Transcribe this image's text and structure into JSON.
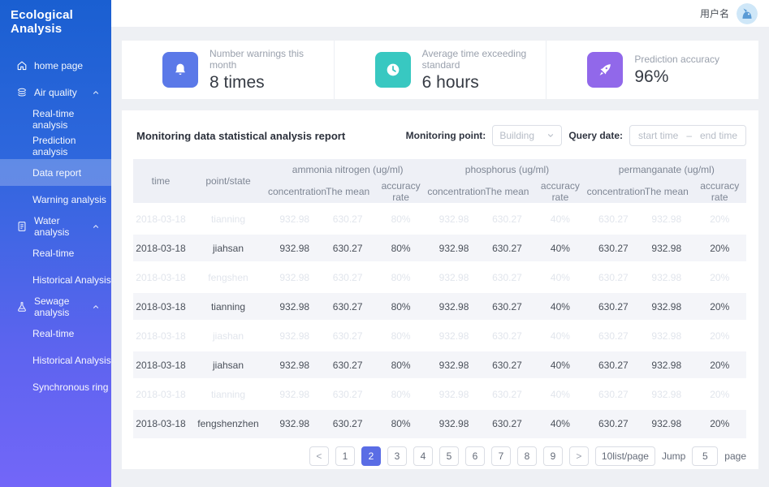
{
  "app": {
    "title": "Ecological Analysis"
  },
  "header": {
    "username": "用户名"
  },
  "sidebar": {
    "items": [
      {
        "label": "home page",
        "icon": "home-icon",
        "type": "item"
      },
      {
        "label": "Air quality",
        "icon": "layers-icon",
        "type": "group",
        "expanded": true
      },
      {
        "label": "Real-time analysis",
        "type": "sub"
      },
      {
        "label": "Prediction analysis",
        "type": "sub"
      },
      {
        "label": "Data report",
        "type": "sub",
        "active": true
      },
      {
        "label": "Warning analysis",
        "type": "sub"
      },
      {
        "label": "Water analysis",
        "icon": "document-icon",
        "type": "group",
        "expanded": true
      },
      {
        "label": "Real-time",
        "type": "sub"
      },
      {
        "label": "Historical Analysis",
        "type": "sub"
      },
      {
        "label": "Sewage analysis",
        "icon": "flask-icon",
        "type": "group",
        "expanded": true
      },
      {
        "label": "Real-time",
        "type": "sub"
      },
      {
        "label": "Historical Analysis",
        "type": "sub"
      },
      {
        "label": "Synchronous ring",
        "type": "sub"
      }
    ]
  },
  "stats": [
    {
      "icon": "bell-icon",
      "color": "#5b79e8",
      "label": "Number warnings this month",
      "value": "8 times"
    },
    {
      "icon": "clock-icon",
      "color": "#38c8c1",
      "label": "Average time exceeding standard",
      "value": "6 hours"
    },
    {
      "icon": "rocket-icon",
      "color": "#9168ea",
      "label": "Prediction accuracy",
      "value": "96%"
    }
  ],
  "colors": {
    "accent": "#5a6de5",
    "sidebar_top": "#1a5fd1",
    "sidebar_bottom": "#7366f8"
  },
  "report": {
    "title": "Monitoring data statistical analysis report",
    "filters": {
      "monitoring_point_label": "Monitoring point:",
      "monitoring_point_value": "Building",
      "query_date_label": "Query date:",
      "start_placeholder": "start time",
      "separator": "–",
      "end_placeholder": "end time"
    },
    "table": {
      "col_time": "time",
      "col_point": "point/state",
      "groups": [
        "ammonia nitrogen (ug/ml)",
        "phosphorus (ug/ml)",
        "permanganate (ug/ml)"
      ],
      "subheaders": [
        "concentration",
        "The mean",
        "accuracy rate"
      ],
      "rows": [
        {
          "time": "2018-03-18",
          "point": "tianning",
          "muted": true,
          "values": [
            "932.98",
            "630.27",
            "80%",
            "932.98",
            "630.27",
            "40%",
            "630.27",
            "932.98",
            "20%"
          ]
        },
        {
          "time": "2018-03-18",
          "point": "jiahsan",
          "muted": false,
          "values": [
            "932.98",
            "630.27",
            "80%",
            "932.98",
            "630.27",
            "40%",
            "630.27",
            "932.98",
            "20%"
          ]
        },
        {
          "time": "2018-03-18",
          "point": "fengshen",
          "muted": true,
          "values": [
            "932.98",
            "630.27",
            "80%",
            "932.98",
            "630.27",
            "40%",
            "630.27",
            "932.98",
            "20%"
          ]
        },
        {
          "time": "2018-03-18",
          "point": "tianning",
          "muted": false,
          "values": [
            "932.98",
            "630.27",
            "80%",
            "932.98",
            "630.27",
            "40%",
            "630.27",
            "932.98",
            "20%"
          ]
        },
        {
          "time": "2018-03-18",
          "point": "jiashan",
          "muted": true,
          "values": [
            "932.98",
            "630.27",
            "80%",
            "932.98",
            "630.27",
            "40%",
            "630.27",
            "932.98",
            "20%"
          ]
        },
        {
          "time": "2018-03-18",
          "point": "jiahsan",
          "muted": false,
          "values": [
            "932.98",
            "630.27",
            "80%",
            "932.98",
            "630.27",
            "40%",
            "630.27",
            "932.98",
            "20%"
          ]
        },
        {
          "time": "2018-03-18",
          "point": "tianning",
          "muted": true,
          "values": [
            "932.98",
            "630.27",
            "80%",
            "932.98",
            "630.27",
            "40%",
            "630.27",
            "932.98",
            "20%"
          ]
        },
        {
          "time": "2018-03-18",
          "point": "fengshenzhen",
          "muted": false,
          "values": [
            "932.98",
            "630.27",
            "80%",
            "932.98",
            "630.27",
            "40%",
            "630.27",
            "932.98",
            "20%"
          ]
        }
      ]
    },
    "pagination": {
      "prev": "<",
      "next": ">",
      "pages": [
        "1",
        "2",
        "3",
        "4",
        "5",
        "6",
        "7",
        "8",
        "9"
      ],
      "active": "2",
      "page_size": "10list/page",
      "jump_label": "Jump",
      "jump_value": "5",
      "page_suffix": "page"
    }
  }
}
